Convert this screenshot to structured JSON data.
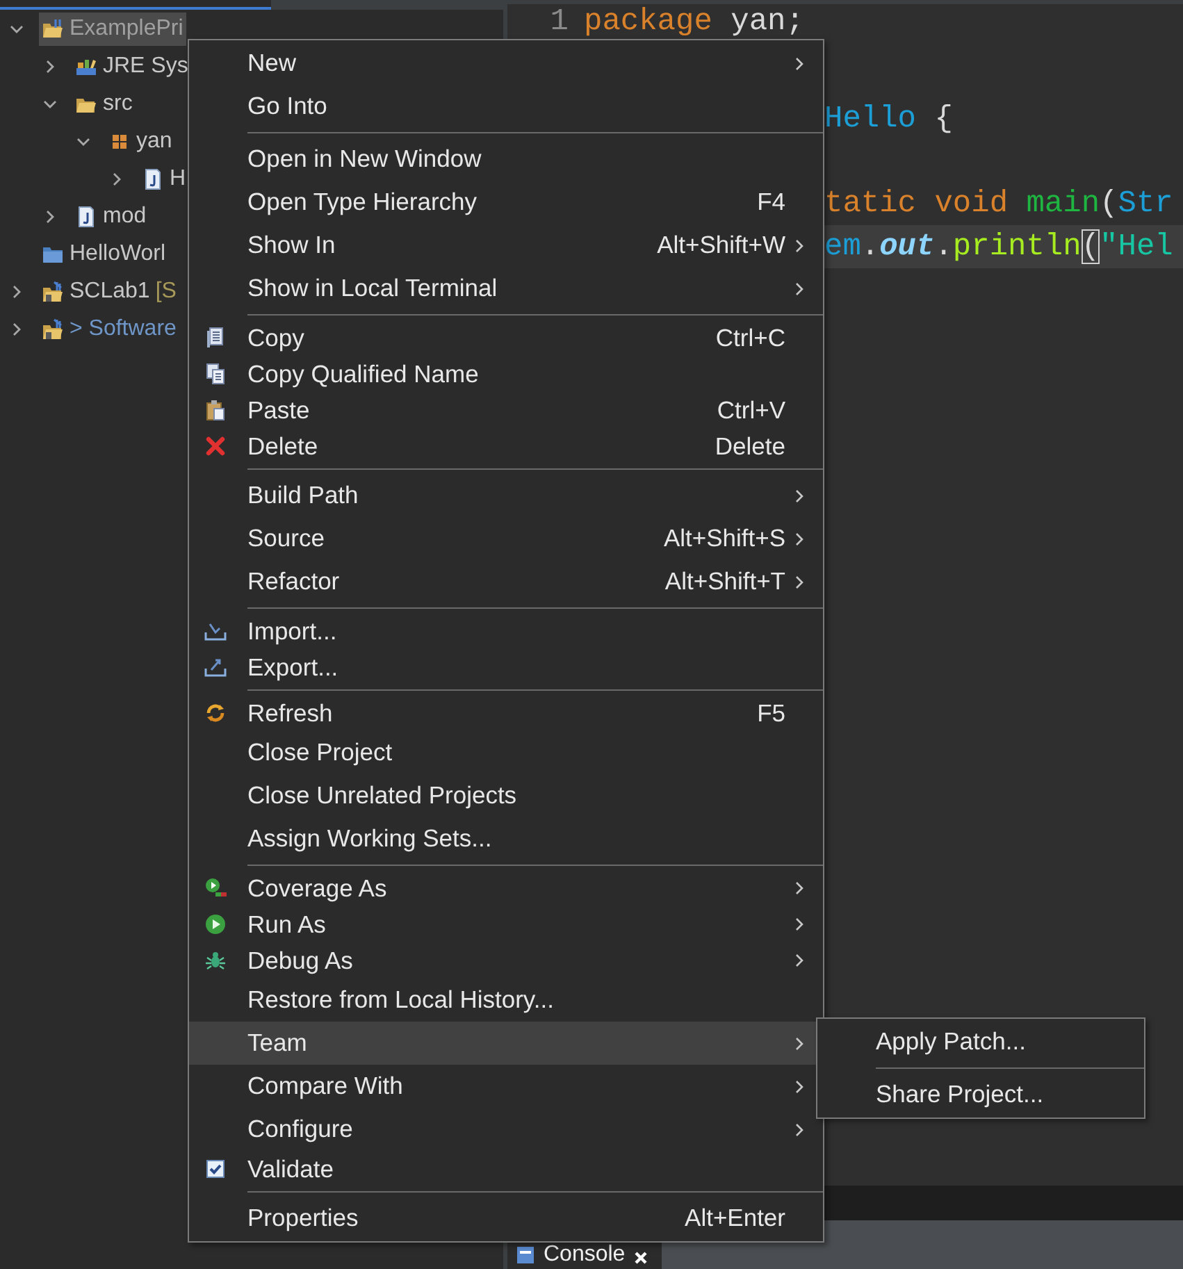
{
  "explorer": {
    "tree": [
      {
        "label": "ExamplePri",
        "kind": "project",
        "expanded": true,
        "selected": true,
        "children": [
          {
            "label": "JRE Sys",
            "kind": "library",
            "expanded": false,
            "selected": false
          },
          {
            "label": "src",
            "kind": "source-folder",
            "expanded": true,
            "selected": false,
            "children": [
              {
                "label": "yan",
                "kind": "package",
                "expanded": true,
                "selected": false,
                "children": [
                  {
                    "label": "H",
                    "kind": "java-file",
                    "expanded": false,
                    "selected": false
                  }
                ]
              }
            ]
          },
          {
            "label": "mod",
            "kind": "java-file",
            "expanded": false,
            "selected": false
          }
        ]
      },
      {
        "label": "HelloWorl",
        "kind": "closed-project",
        "selected": false
      },
      {
        "label": "SCLab1",
        "decoration": "[S",
        "kind": "shared-project",
        "expanded": false,
        "selected": false
      },
      {
        "label": "> Software",
        "kind": "shared-project",
        "dirty": true,
        "expanded": false,
        "selected": false
      }
    ]
  },
  "editor": {
    "lines": [
      {
        "number": "1",
        "kind": "full",
        "current": false,
        "tokens": [
          {
            "text": "package",
            "kind": "keyword"
          },
          {
            "text": " yan;",
            "kind": "plain"
          }
        ]
      },
      {
        "kind": "clipped",
        "current": false,
        "tokens": [
          {
            "text": "Hello",
            "kind": "type"
          },
          {
            "text": " {",
            "kind": "plain"
          }
        ]
      },
      {
        "kind": "clipped",
        "current": false,
        "tokens": [
          {
            "text": "tatic void",
            "kind": "keyword"
          },
          {
            "text": " main",
            "kind": "method"
          },
          {
            "text": "(",
            "kind": "plain"
          },
          {
            "text": "Str",
            "kind": "type"
          }
        ]
      },
      {
        "kind": "clipped",
        "current": true,
        "tokens": [
          {
            "text": "em",
            "kind": "type"
          },
          {
            "text": ".",
            "kind": "plain"
          },
          {
            "text": "out",
            "kind": "field"
          },
          {
            "text": ".",
            "kind": "plain"
          },
          {
            "text": "println",
            "kind": "call"
          },
          {
            "text": "(",
            "kind": "bracket"
          },
          {
            "text": "\"Hel",
            "kind": "string"
          }
        ]
      }
    ]
  },
  "context_menu": {
    "groups": [
      {
        "items": [
          {
            "label": "New",
            "kind": "none",
            "submenu": true,
            "selected": false
          },
          {
            "label": "Go Into",
            "kind": "none",
            "submenu": false,
            "selected": false
          }
        ]
      },
      {
        "items": [
          {
            "label": "Open in New Window",
            "kind": "none",
            "submenu": false,
            "selected": false
          },
          {
            "label": "Open Type Hierarchy",
            "shortcut": "F4",
            "kind": "none",
            "submenu": false,
            "selected": false
          },
          {
            "label": "Show In",
            "shortcut": "Alt+Shift+W",
            "kind": "none",
            "submenu": true,
            "selected": false
          },
          {
            "label": "Show in Local Terminal",
            "kind": "none",
            "submenu": true,
            "selected": false
          }
        ]
      },
      {
        "items": [
          {
            "label": "Copy",
            "shortcut": "Ctrl+C",
            "kind": "copy",
            "submenu": false,
            "selected": false
          },
          {
            "label": "Copy Qualified Name",
            "kind": "copy-name",
            "submenu": false,
            "selected": false
          },
          {
            "label": "Paste",
            "shortcut": "Ctrl+V",
            "kind": "paste",
            "submenu": false,
            "selected": false
          },
          {
            "label": "Delete",
            "shortcut": "Delete",
            "kind": "delete",
            "submenu": false,
            "selected": false
          }
        ]
      },
      {
        "items": [
          {
            "label": "Build Path",
            "kind": "none",
            "submenu": true,
            "selected": false
          },
          {
            "label": "Source",
            "shortcut": "Alt+Shift+S",
            "kind": "none",
            "submenu": true,
            "selected": false
          },
          {
            "label": "Refactor",
            "shortcut": "Alt+Shift+T",
            "kind": "none",
            "submenu": true,
            "selected": false
          }
        ]
      },
      {
        "items": [
          {
            "label": "Import...",
            "kind": "import",
            "submenu": false,
            "selected": false
          },
          {
            "label": "Export...",
            "kind": "export",
            "submenu": false,
            "selected": false
          }
        ]
      },
      {
        "items": [
          {
            "label": "Refresh",
            "shortcut": "F5",
            "kind": "refresh",
            "submenu": false,
            "selected": false
          },
          {
            "label": "Close Project",
            "kind": "none",
            "submenu": false,
            "selected": false
          },
          {
            "label": "Close Unrelated Projects",
            "kind": "none",
            "submenu": false,
            "selected": false
          },
          {
            "label": "Assign Working Sets...",
            "kind": "none",
            "submenu": false,
            "selected": false
          }
        ]
      },
      {
        "items": [
          {
            "label": "Coverage As",
            "kind": "coverage",
            "submenu": true,
            "selected": false
          },
          {
            "label": "Run As",
            "kind": "run",
            "submenu": true,
            "selected": false
          },
          {
            "label": "Debug As",
            "kind": "debug",
            "submenu": true,
            "selected": false
          },
          {
            "label": "Restore from Local History...",
            "kind": "none",
            "submenu": false,
            "selected": false
          },
          {
            "label": "Team",
            "kind": "none",
            "submenu": true,
            "selected": true
          },
          {
            "label": "Compare With",
            "kind": "none",
            "submenu": true,
            "selected": false
          },
          {
            "label": "Configure",
            "kind": "none",
            "submenu": true,
            "selected": false
          },
          {
            "label": "Validate",
            "kind": "check",
            "checked": true,
            "submenu": false,
            "selected": false
          }
        ]
      },
      {
        "items": [
          {
            "label": "Properties",
            "shortcut": "Alt+Enter",
            "kind": "none",
            "submenu": false,
            "selected": false
          }
        ]
      }
    ]
  },
  "submenu": {
    "groups": [
      {
        "items": [
          {
            "label": "Apply Patch...",
            "submenu": false,
            "selected": false
          }
        ]
      },
      {
        "items": [
          {
            "label": "Share Project...",
            "submenu": false,
            "selected": false
          }
        ]
      }
    ]
  },
  "bottom_panel": {
    "tabs": [
      {
        "label": "Console",
        "selected": true
      }
    ]
  }
}
